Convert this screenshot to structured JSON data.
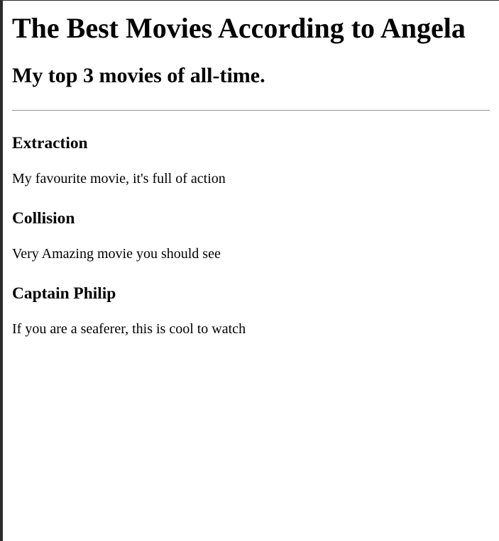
{
  "title": "The Best Movies According to Angela",
  "subtitle": "My top 3 movies of all-time.",
  "movies": [
    {
      "name": "Extraction",
      "description": "My favourite movie, it's full of action"
    },
    {
      "name": "Collision",
      "description": "Very Amazing movie you should see"
    },
    {
      "name": "Captain Philip",
      "description": "If you are a seaferer, this is cool to watch"
    }
  ]
}
